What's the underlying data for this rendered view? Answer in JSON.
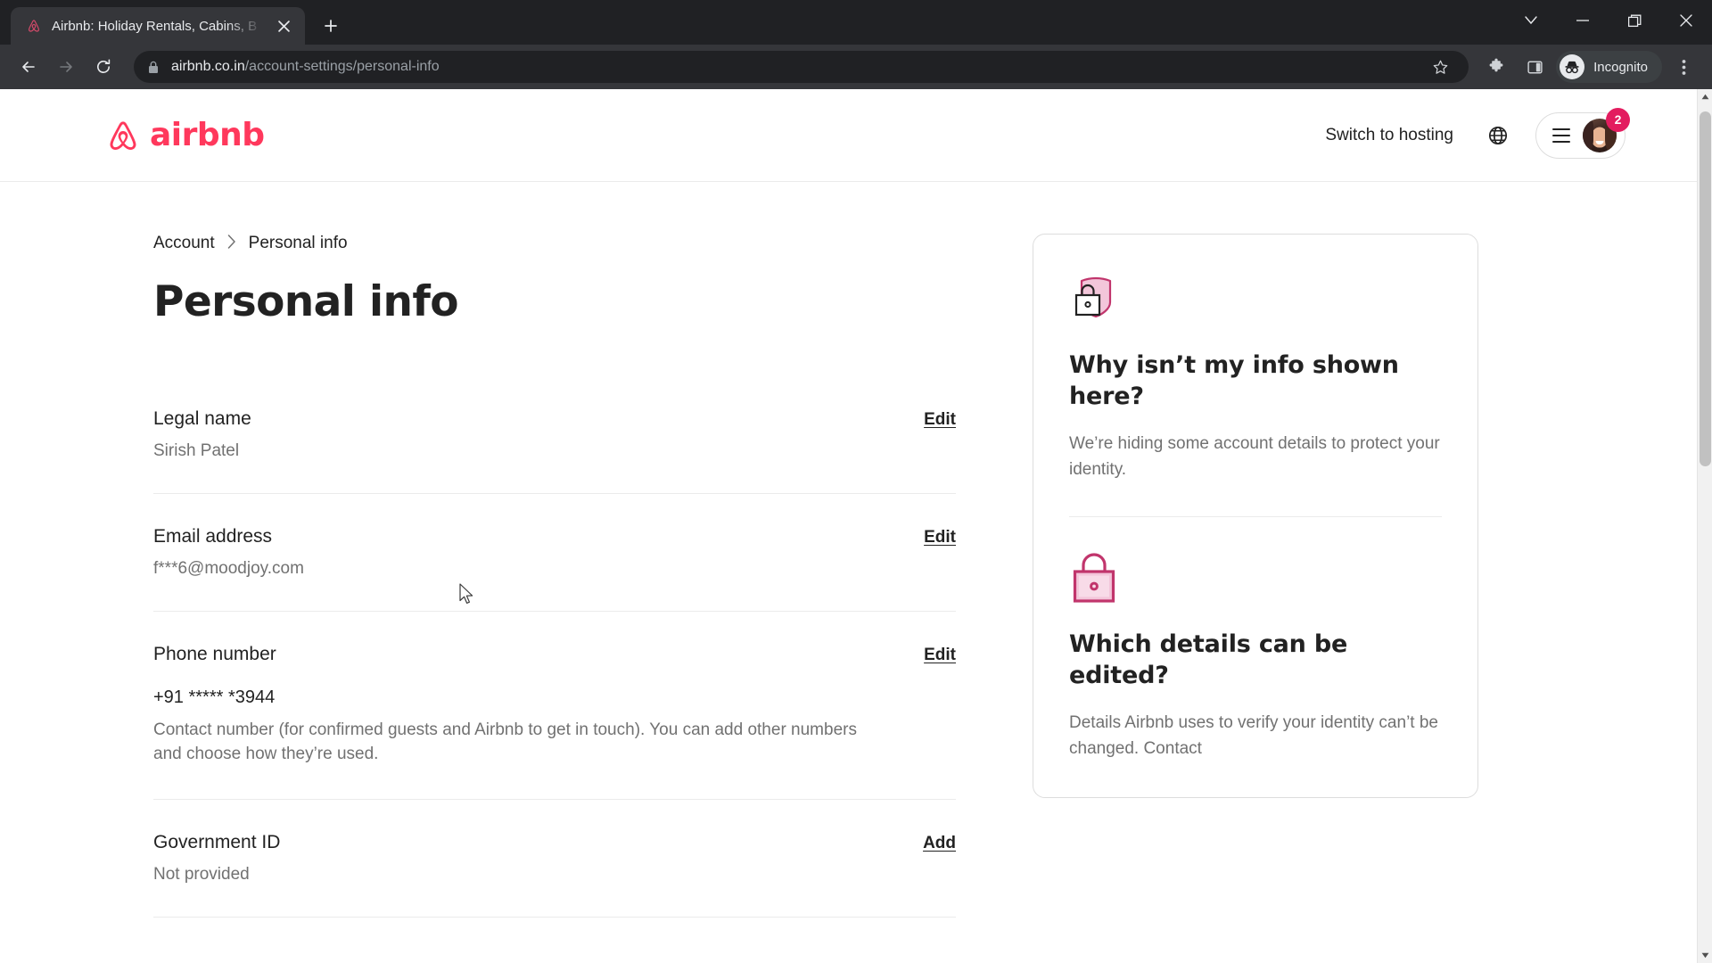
{
  "browser": {
    "tab": {
      "title": "Airbnb: Holiday Rentals, Cabins, B",
      "favicon_name": "airbnb-favicon",
      "close_label": "×"
    },
    "new_tab_label": "+",
    "window_controls": [
      {
        "name": "chevron-down-button",
        "glyph": "⌄"
      },
      {
        "name": "minimize-button",
        "glyph": "—"
      },
      {
        "name": "restore-button",
        "glyph": "❐"
      },
      {
        "name": "close-button",
        "glyph": "✕"
      }
    ],
    "nav": {
      "back_label": "←",
      "forward_label": "→",
      "reload_label": "↻"
    },
    "omnibox": {
      "url_domain": "airbnb.co.in",
      "url_path": "/account-settings/personal-info",
      "lock_icon": "padlock-icon",
      "star_icon": "bookmark-star-icon"
    },
    "toolbar_icons": [
      {
        "name": "extensions-icon"
      },
      {
        "name": "side-panel-icon"
      }
    ],
    "incognito_label": "Incognito",
    "menu_label": "⋮"
  },
  "site": {
    "logo_text": "airbnb",
    "brand_color": "#ff385c",
    "header": {
      "switch_to_hosting": "Switch to hosting",
      "globe_icon": "globe-icon",
      "menu_icon": "hamburger-icon",
      "avatar_name": "user-avatar",
      "notification_count": "2",
      "badge_color": "#e31c5f"
    },
    "breadcrumb": {
      "items": [
        "Account",
        "Personal info"
      ],
      "separator": "›"
    },
    "page_title": "Personal info",
    "fields": [
      {
        "label": "Legal name",
        "value": "Sirish Patel",
        "action": "Edit",
        "help": ""
      },
      {
        "label": "Email address",
        "value": "f***6@moodjoy.com",
        "action": "Edit",
        "help": ""
      },
      {
        "label": "Phone number",
        "value": "+91 ***** *3944",
        "action": "Edit",
        "help": "Contact number (for confirmed guests and Airbnb to get in touch). You can add other numbers and choose how they’re used."
      },
      {
        "label": "Government ID",
        "value": "Not provided",
        "action": "Add",
        "help": ""
      }
    ],
    "info_card": {
      "sections": [
        {
          "icon": "shield-lock-icon",
          "title": "Why isn’t my info shown here?",
          "body": "We’re hiding some account details to protect your identity."
        },
        {
          "icon": "padlock-icon",
          "title": "Which details can be edited?",
          "body": "Details Airbnb uses to verify your identity can’t be changed. Contact"
        }
      ]
    }
  },
  "scrollbar": {
    "up_arrow": "▲",
    "down_arrow": "▼"
  }
}
